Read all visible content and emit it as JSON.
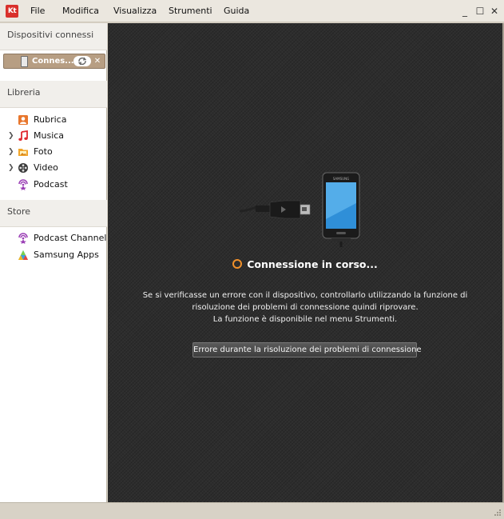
{
  "menu": {
    "logo": "Kt",
    "items": [
      "File",
      "Modifica",
      "Visualizza",
      "Strumenti",
      "Guida"
    ]
  },
  "window_controls": {
    "minimize": "_",
    "maximize": "☐",
    "close": "✕"
  },
  "sidebar": {
    "connected_header": "Dispositivi connessi",
    "device": {
      "label": "Connes...",
      "sync_icon": "sync-icon",
      "close_icon": "close-icon"
    },
    "library_header": "Libreria",
    "library_items": [
      {
        "label": "Rubrica",
        "icon": "contacts-icon",
        "expandable": false
      },
      {
        "label": "Musica",
        "icon": "music-icon",
        "expandable": true
      },
      {
        "label": "Foto",
        "icon": "photo-icon",
        "expandable": true
      },
      {
        "label": "Video",
        "icon": "video-icon",
        "expandable": true
      },
      {
        "label": "Podcast",
        "icon": "podcast-icon",
        "expandable": false
      }
    ],
    "store_header": "Store",
    "store_items": [
      {
        "label": "Podcast Channel",
        "icon": "podcast-icon"
      },
      {
        "label": "Samsung Apps",
        "icon": "samsung-apps-icon"
      }
    ]
  },
  "main": {
    "status": "Connessione in corso...",
    "message_lines": [
      "Se si verificasse un errore con il dispositivo, controllarlo utilizzando la funzione di",
      "risoluzione dei problemi di connessione quindi riprovare.",
      "La funzione è disponibile nel menu Strumenti."
    ],
    "error_button": "Errore durante la risoluzione dei problemi di connessione",
    "phone_brand": "SAMSUNG"
  },
  "colors": {
    "accent_orange": "#f0902a",
    "device_selected": "#b79e83",
    "main_bg": "#2d2d2d"
  }
}
